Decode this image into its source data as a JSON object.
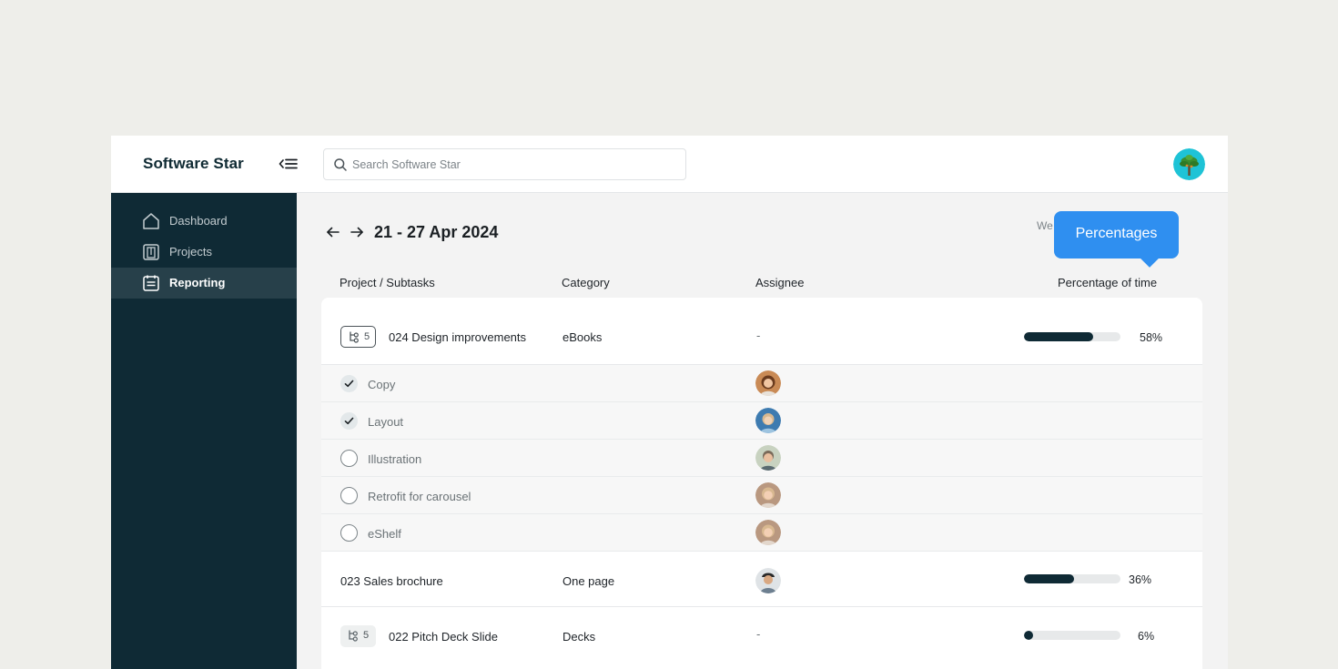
{
  "app": {
    "brand": "Software Star"
  },
  "search": {
    "placeholder": "Search Software Star"
  },
  "sidebar": {
    "items": [
      {
        "label": "Dashboard",
        "icon": "home-icon",
        "active": false
      },
      {
        "label": "Projects",
        "icon": "projects-icon",
        "active": false
      },
      {
        "label": "Reporting",
        "icon": "reporting-icon",
        "active": true
      }
    ]
  },
  "report": {
    "date_range": "21 - 27 Apr 2024",
    "view_tab_partial": "We",
    "tooltip": "Percentages"
  },
  "table": {
    "columns": [
      "Project / Subtasks",
      "Category",
      "Assignee",
      "Percentage of time"
    ],
    "projects": [
      {
        "name": "024 Design improvements",
        "category": "eBooks",
        "assignee": "-",
        "subtask_count": "5",
        "percent_label": "58%",
        "percent": 0.72,
        "subtasks": [
          {
            "name": "Copy",
            "done": true
          },
          {
            "name": "Layout",
            "done": true
          },
          {
            "name": "Illustration",
            "done": false
          },
          {
            "name": "Retrofit for carousel",
            "done": false
          },
          {
            "name": "eShelf",
            "done": false
          }
        ]
      },
      {
        "name": "023 Sales brochure",
        "category": "One page",
        "assignee": "",
        "percent_label": "36%",
        "percent": 0.52
      },
      {
        "name": "022 Pitch Deck Slide",
        "category": "Decks",
        "assignee": "-",
        "subtask_count": "5",
        "percent_label": "6%",
        "percent": 0.09
      }
    ]
  },
  "colors": {
    "sidebar": "#0f2a35",
    "accent": "#2f8ff0",
    "bar_fill": "#0f2a35"
  }
}
